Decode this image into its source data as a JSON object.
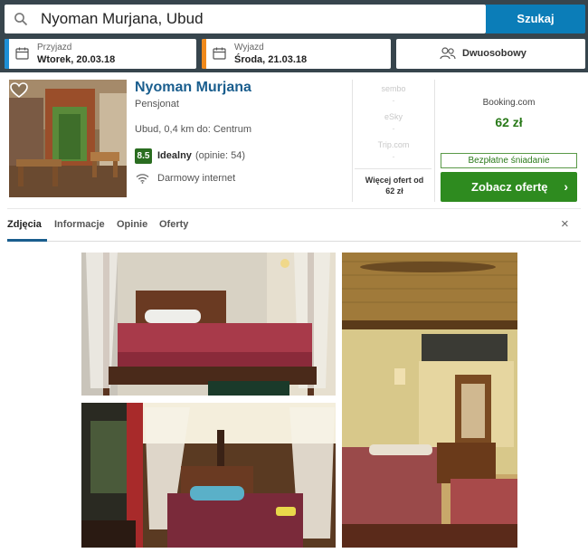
{
  "search": {
    "query": "Nyoman Murjana, Ubud",
    "button_label": "Szukaj"
  },
  "checkin": {
    "label": "Przyjazd",
    "value": "Wtorek, 20.03.18"
  },
  "checkout": {
    "label": "Wyjazd",
    "value": "Środa, 21.03.18"
  },
  "room": {
    "label": "Dwuosobowy"
  },
  "hotel": {
    "name": "Nyoman Murjana",
    "type": "Pensjonat",
    "location": "Ubud, 0,4 km do: Centrum",
    "rating": "8.5",
    "rating_label": "Idealny",
    "rating_count": "(opinie: 54)",
    "amenity": "Darmowy internet"
  },
  "other_offers": [
    {
      "provider": "sembo",
      "price": "-"
    },
    {
      "provider": "eSky",
      "price": "-"
    },
    {
      "provider": "Trip.com",
      "price": "-"
    }
  ],
  "more_offers": {
    "label": "Więcej ofert od",
    "price": "62 zł"
  },
  "best_offer": {
    "provider": "Booking.com",
    "price": "62 zł",
    "badge": "Bezpłatne śniadanie",
    "cta_label": "Zobacz ofertę",
    "cta_arrow": "›"
  },
  "tabs": [
    "Zdjęcia",
    "Informacje",
    "Opinie",
    "Oferty"
  ],
  "close_icon": "×",
  "colors": {
    "topbar": "#37454d",
    "search_button": "#0b7db8",
    "checkin_stripe": "#1e8fd6",
    "checkout_stripe": "#f08a1c",
    "hotel_name": "#1a5e8e",
    "rating_badge": "#2a6d20",
    "cta": "#2e8b1f"
  },
  "icons": [
    "search-icon",
    "calendar-icon",
    "people-icon",
    "heart-icon",
    "wifi-icon",
    "close-icon",
    "chevron-right-icon"
  ]
}
